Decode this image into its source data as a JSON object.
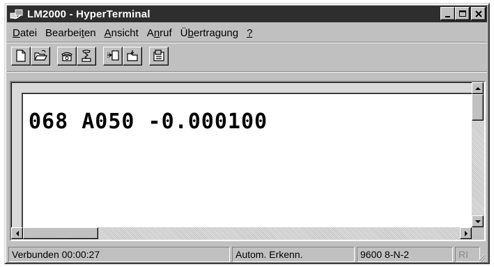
{
  "window": {
    "title": "LM2000 - HyperTerminal",
    "controls": {
      "minimize": "_",
      "maximize": "□",
      "close": "×"
    }
  },
  "menu": {
    "items": [
      {
        "pre": "",
        "u": "D",
        "post": "atei"
      },
      {
        "pre": "Bearbei",
        "u": "t",
        "post": "en"
      },
      {
        "pre": "",
        "u": "A",
        "post": "nsicht"
      },
      {
        "pre": "A",
        "u": "n",
        "post": "ruf"
      },
      {
        "pre": "Ü",
        "u": "b",
        "post": "ertragung"
      },
      {
        "pre": "",
        "u": "?",
        "post": ""
      }
    ]
  },
  "toolbar": {
    "icons": [
      "new-document-icon",
      "open-folder-icon",
      "call-phone-icon",
      "hang-up-phone-icon",
      "send-file-icon",
      "receive-file-icon",
      "properties-icon"
    ]
  },
  "terminal": {
    "line1": "068 A050 -0.000100"
  },
  "status": {
    "connection": "Verbunden 00:00:27",
    "detection": "Autom. Erkenn.",
    "port_settings": "9600 8-N-2",
    "indicator": "RI"
  },
  "colors": {
    "titlebar": "#2e2e2e",
    "chrome": "#c0c0c0",
    "screen": "#ffffff"
  }
}
